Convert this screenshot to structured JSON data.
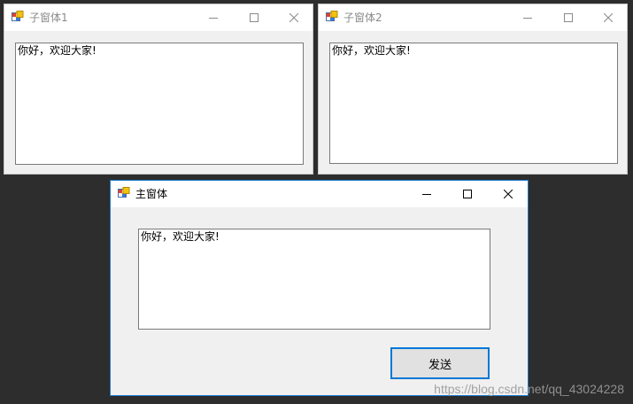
{
  "windows": {
    "child1": {
      "title": "子窗体1",
      "textbox_value": "你好，欢迎大家!"
    },
    "child2": {
      "title": "子窗体2",
      "textbox_value": "你好，欢迎大家!"
    },
    "main": {
      "title": "主窗体",
      "textbox_value": "你好，欢迎大家!",
      "send_label": "发送"
    }
  },
  "watermark": "https://blog.csdn.net/qq_43024228",
  "icons": {
    "app": "app-form-icon",
    "minimize": "minimize-icon",
    "maximize": "maximize-icon",
    "close": "close-icon"
  },
  "colors": {
    "desktop": "#2d2d2d",
    "window_bg": "#f0f0f0",
    "active_border": "#1979ca",
    "button_focus": "#0078d7"
  }
}
